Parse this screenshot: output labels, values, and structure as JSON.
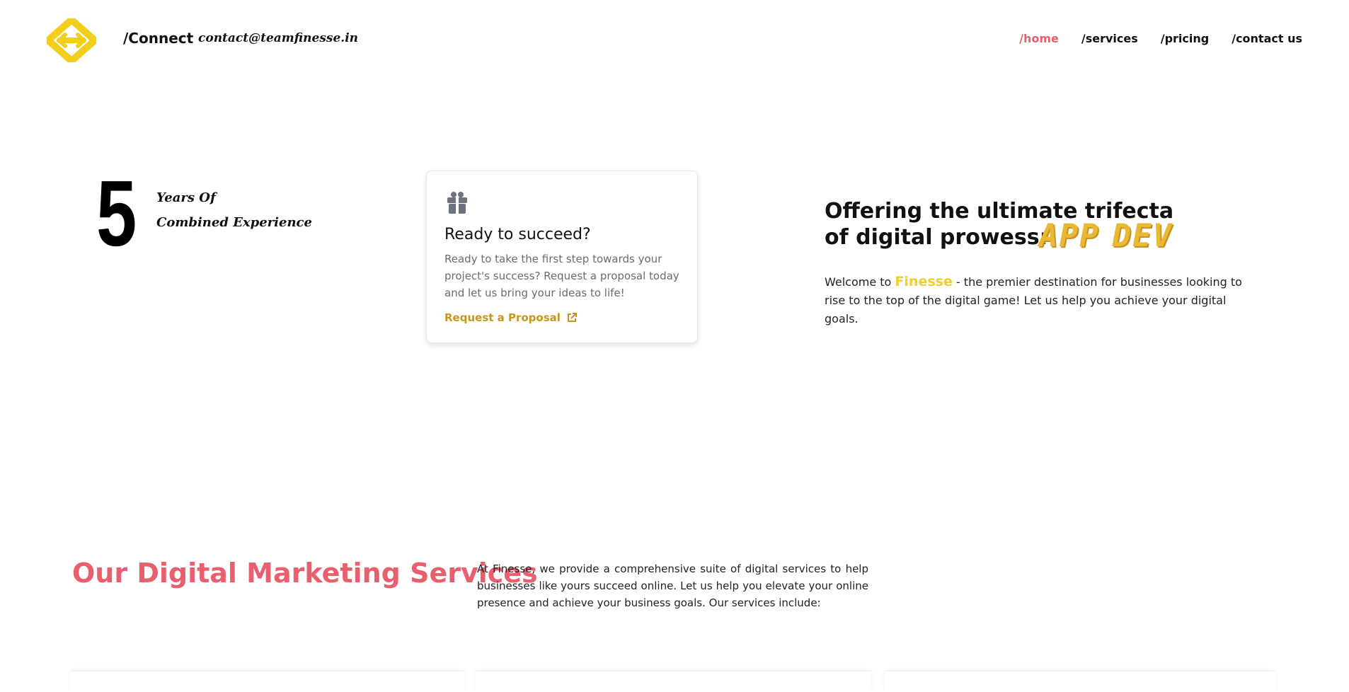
{
  "header": {
    "connect_label": "/Connect",
    "email": "contact@teamfinesse.in",
    "nav": [
      {
        "label": "/home",
        "active": true
      },
      {
        "label": "/services",
        "active": false
      },
      {
        "label": "/pricing",
        "active": false
      },
      {
        "label": "/contact us",
        "active": false
      }
    ]
  },
  "experience": {
    "number": "5",
    "line1": "Years Of",
    "line2": "Combined Experience"
  },
  "card": {
    "icon": "gift-icon",
    "title": "Ready to succeed?",
    "description": "Ready to take the first step towards your project's success? Request a proposal today and let us bring your ideas to life!",
    "link_label": "Request a Proposal"
  },
  "offer": {
    "title": "Offering the ultimate trifecta of digital prowess:",
    "badges": [
      "APP",
      "DEV"
    ],
    "desc_prefix": "Welcome to ",
    "brand": "Finesse",
    "desc_suffix": " - the premier destination for businesses looking to rise to the top of the digital game! Let us help you achieve your digital goals."
  },
  "services": {
    "title": "Our Digital Marketing Services",
    "description": "At Finesse, we provide a comprehensive suite of digital services to help businesses like yours succeed online. Let us help you elevate your online presence and achieve your business goals. Our services include:"
  },
  "colors": {
    "accent_pink": "#e8606e",
    "brand_yellow": "#f5cd29",
    "link_gold": "#c9961a"
  }
}
